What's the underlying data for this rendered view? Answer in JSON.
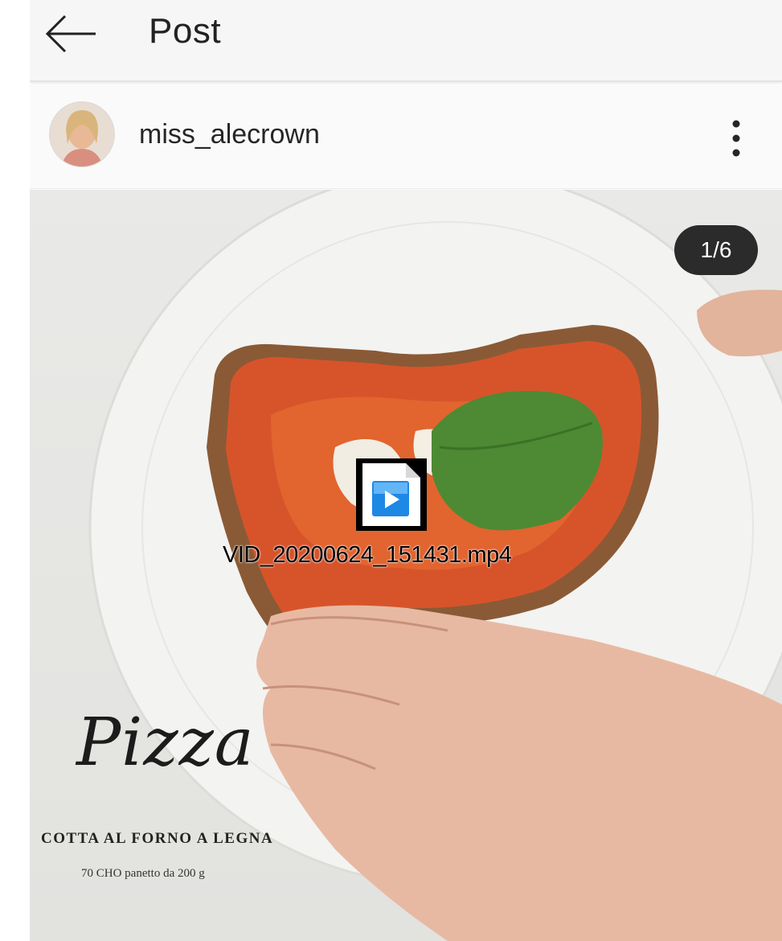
{
  "header": {
    "title": "Post",
    "back_icon": "arrow-left-icon"
  },
  "post": {
    "username": "miss_alecrown",
    "more_icon": "more-vertical-icon",
    "counter": "1/6",
    "image_caption": {
      "title": "Pizza",
      "subtitle": "COTTA AL FORNO A LEGNA",
      "detail": "70 CHO panetto da 200 g"
    }
  },
  "file_overlay": {
    "filename": "VID_20200624_151431.mp4",
    "icon": "video-file-icon"
  },
  "colors": {
    "header_bg": "#f6f6f6",
    "badge_bg": "#2b2b2b",
    "text_primary": "#262626"
  }
}
